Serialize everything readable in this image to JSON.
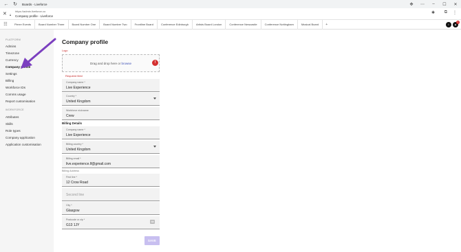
{
  "browser": {
    "tab_title": "Boards - Liveforce",
    "url": "https://admin.liveforce.co",
    "page_title": "Company profile - Liveforce"
  },
  "boards": {
    "tabs": [
      "Pierre Events",
      "Board Number Three",
      "Board Number One",
      "Board Number Two",
      "Frontline Board",
      "Conference Edinburgh",
      "Artists Board London",
      "Conference Newcastle",
      "Conference Nottingham",
      "Musical Board"
    ],
    "avatar_badge": "1"
  },
  "sidebar": {
    "platform_heading": "PLATFORM",
    "platform_items": [
      "Admins",
      "Timezone",
      "Currency",
      "Company profile",
      "Settings",
      "Billing",
      "Workforce IDs",
      "Comms usage",
      "Report customisation"
    ],
    "workforce_heading": "WORKFORCE",
    "workforce_items": [
      "Attributes",
      "Skills",
      "Role types",
      "Company application",
      "Application customisation"
    ]
  },
  "main": {
    "title": "Company profile",
    "logo_label": "Logo",
    "dropzone_text": "Drag and drop here or ",
    "dropzone_link": "browse",
    "error_badge": "!",
    "required_text": "Required field",
    "company_name_label": "Company name *",
    "company_name": "Live Experience",
    "country_label": "Country *",
    "country": "United Kingdom",
    "nickname_label": "Workforce nickname",
    "nickname": "Crew",
    "billing_heading": "Billing Details",
    "billing_company_label": "Company name *",
    "billing_company": "Live Experience",
    "billing_country_label": "Billing country *",
    "billing_country": "United Kingdom",
    "billing_email_label": "Billing email *",
    "billing_email": "live.experience.lf@gmail.com",
    "billing_address_label": "Billing Address",
    "first_line_label": "First line *",
    "first_line": "12 Crow Road",
    "second_line_placeholder": "Second line",
    "city_label": "City *",
    "city": "Glasgow",
    "postcode_label": "Postcode or zip *",
    "postcode": "G13 1JY",
    "save_label": "SAVE"
  },
  "colors": {
    "accent": "#3f51b5",
    "error": "#c62828",
    "save_disabled": "#c8bff0",
    "annotation_arrow": "#7b3fbf"
  }
}
